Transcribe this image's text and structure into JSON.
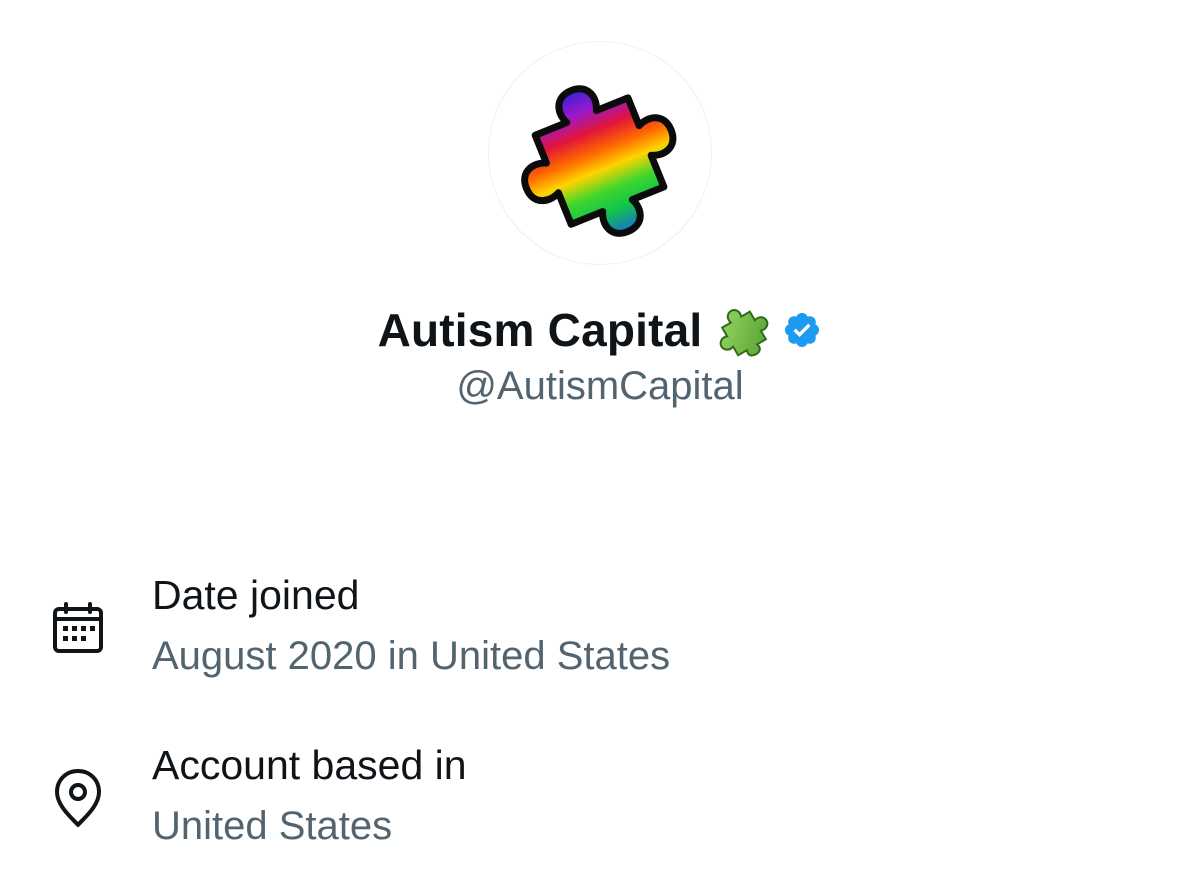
{
  "profile": {
    "avatar": "rainbow-puzzle-piece-avatar",
    "display_name": "Autism Capital",
    "name_emoji": "puzzle-piece-emoji",
    "verified_badge": "verified-badge-icon",
    "handle": "@AutismCapital"
  },
  "about": {
    "joined": {
      "icon": "calendar-icon",
      "label": "Date joined",
      "value": "August 2020 in United States"
    },
    "based_in": {
      "icon": "location-pin-icon",
      "label": "Account based in",
      "value": "United States"
    }
  },
  "colors": {
    "primary_text": "#0f1419",
    "secondary_text": "#536471",
    "verified_blue": "#1d9bf0",
    "background": "#ffffff"
  }
}
